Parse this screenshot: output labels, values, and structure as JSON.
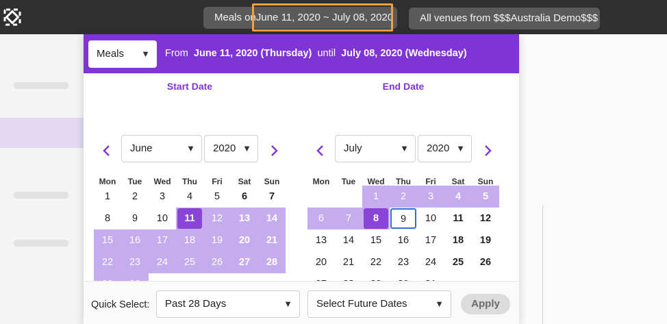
{
  "topbar": {
    "meals_prefix": "Meals on",
    "date_range": "June 11, 2020 ~ July 08, 2020",
    "venue_label": "All venues from $$$Australia Demo$$$"
  },
  "popup": {
    "type_select": "Meals",
    "from_label": "From",
    "from_date": "June 11, 2020 (Thursday)",
    "until_label": "until",
    "until_date": "July 08, 2020 (Wednesday)",
    "weekdays": [
      "Mon",
      "Tue",
      "Wed",
      "Thu",
      "Fri",
      "Sat",
      "Sun"
    ],
    "start": {
      "title": "Start Date",
      "month": "June",
      "year": "2020"
    },
    "end": {
      "title": "End Date",
      "month": "July",
      "year": "2020"
    },
    "footer": {
      "quick_select_label": "Quick Select:",
      "quick_select_value": "Past 28 Days",
      "future_select_value": "Select Future Dates",
      "apply_label": "Apply"
    }
  },
  "icons": {
    "prev": "chevron-left-icon",
    "next": "chevron-right-icon",
    "dropdown": "chevron-down-icon"
  },
  "colors": {
    "accent": "#7f34d6",
    "range": "#c4acee",
    "endpoint": "#8a45d8",
    "today_border": "#2f6fd6",
    "highlight": "#f0a040"
  }
}
